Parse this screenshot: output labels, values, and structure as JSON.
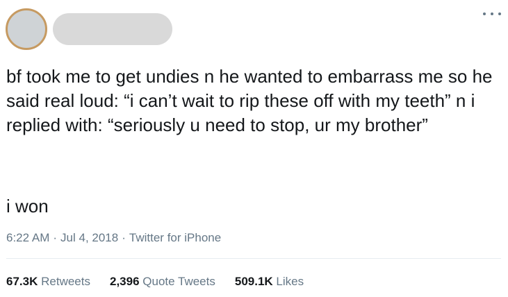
{
  "tweet": {
    "text": "bf took me to get undies n he wanted to embarrass me so he said real loud: “i can’t wait to rip these off with my teeth” n i replied with: “seriously u need to stop, ur my brother”",
    "text_followup": "i won",
    "time": "6:22 AM",
    "date": "Jul 4, 2018",
    "separator": "·",
    "source": "Twitter for iPhone"
  },
  "stats": {
    "retweets_count": "67.3K",
    "retweets_label": "Retweets",
    "quotes_count": "2,396",
    "quotes_label": "Quote Tweets",
    "likes_count": "509.1K",
    "likes_label": "Likes"
  },
  "icons": {
    "more": "more-horizontal-icon"
  },
  "colors": {
    "text": "#14171a",
    "secondary": "#657786",
    "divider": "#e6ecf0",
    "avatar_ring": "#c69a61",
    "redacted": "#d9d9d9"
  }
}
